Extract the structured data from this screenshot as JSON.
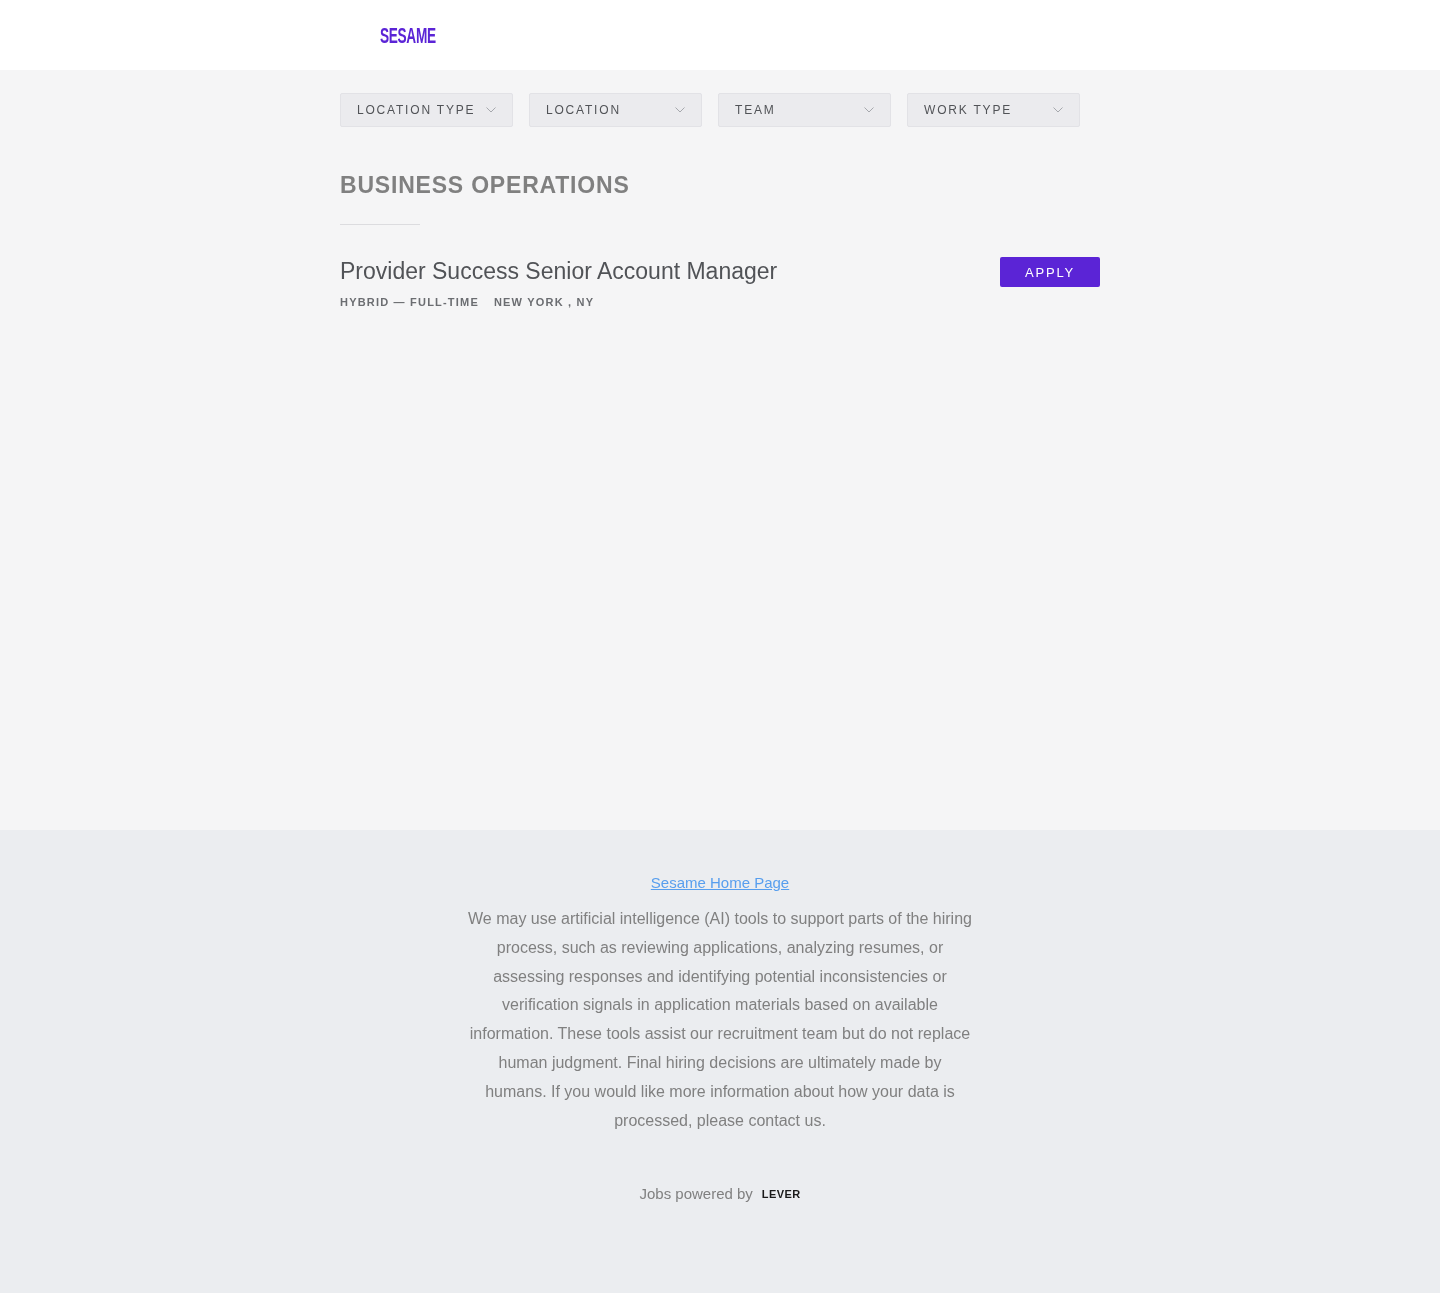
{
  "header": {
    "logo": "SESAME"
  },
  "filters": [
    {
      "label": "LOCATION TYPE"
    },
    {
      "label": "LOCATION"
    },
    {
      "label": "TEAM"
    },
    {
      "label": "WORK TYPE"
    }
  ],
  "team_section": {
    "title": "BUSINESS OPERATIONS",
    "postings": [
      {
        "title": "Provider Success Senior Account Manager",
        "workplace_commitment": "HYBRID — FULL-TIME",
        "location": "NEW YORK , NY",
        "apply_button": "APPLY"
      }
    ]
  },
  "footer": {
    "home_link": "Sesame Home Page",
    "notice": "We may use artificial intelligence (AI) tools to support parts of the hiring process, such as reviewing applications, analyzing resumes, or assessing responses and identifying potential inconsistencies or verification signals in application materials based on available information. These tools assist our recruitment team but do not replace human judgment. Final hiring decisions are ultimately made by humans. If you would like more information about how your data is processed, please contact us.",
    "powered_by": "Jobs powered by",
    "powered_by_logo": "LEVER"
  }
}
